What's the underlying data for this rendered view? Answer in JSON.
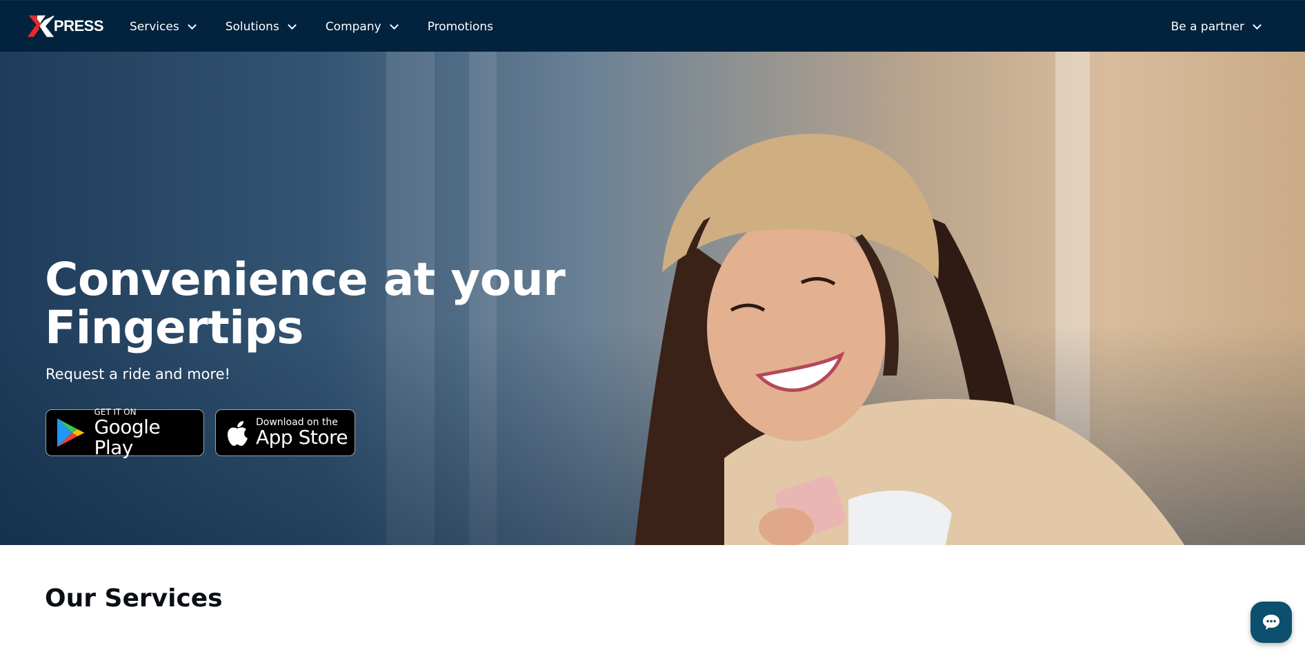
{
  "brand": {
    "logo_text": "PRESS",
    "accent": "#e52b2b",
    "nav_bg": "#03223d"
  },
  "nav": {
    "items": [
      {
        "label": "Services",
        "has_dropdown": true
      },
      {
        "label": "Solutions",
        "has_dropdown": true
      },
      {
        "label": "Company",
        "has_dropdown": true
      },
      {
        "label": "Promotions",
        "has_dropdown": false
      }
    ],
    "partner_label": "Be a partner"
  },
  "hero": {
    "title_line1": "Convenience at your",
    "title_line2": "Fingertips",
    "subtitle": "Request a ride and more!",
    "google_play": {
      "small": "GET IT ON",
      "big": "Google Play"
    },
    "app_store": {
      "small": "Download on the",
      "big": "App Store"
    }
  },
  "services": {
    "title": "Our Services"
  },
  "chat": {
    "icon": "chat-bubble-icon"
  }
}
